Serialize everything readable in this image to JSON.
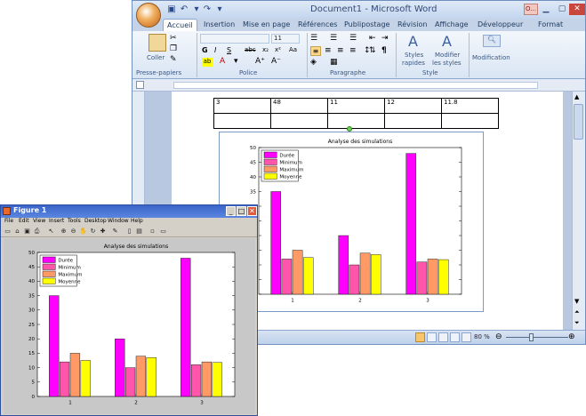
{
  "word": {
    "title": "Document1 - Microsoft Word",
    "contextual_tab": "O...",
    "tabs": [
      "Accueil",
      "Insertion",
      "Mise en page",
      "Références",
      "Publipostage",
      "Révision",
      "Affichage",
      "Développeur",
      "Format"
    ],
    "active_tab": "Accueil",
    "ribbon": {
      "paste_label": "Coller",
      "clipboard_group": "Presse-papiers",
      "font_group": "Police",
      "font_size": "11",
      "paragraph_group": "Paragraphe",
      "styles_group": "Style",
      "quick_styles_label_1": "Styles",
      "quick_styles_label_2": "rapides",
      "change_styles_label_1": "Modifier",
      "change_styles_label_2": "les styles",
      "editing_label": "Modification"
    },
    "table_row": [
      "3",
      "48",
      "11",
      "12",
      "11.8"
    ],
    "zoom": "80 %"
  },
  "figure": {
    "title": "Figure 1",
    "menu": [
      "File",
      "Edit",
      "View",
      "Insert",
      "Tools",
      "Desktop",
      "Window",
      "Help"
    ]
  },
  "chart_data": [
    {
      "type": "bar",
      "title": "Analyse des simulations",
      "categories": [
        "1",
        "2",
        "3"
      ],
      "series": [
        {
          "name": "Durée",
          "values": [
            35,
            20,
            48
          ]
        },
        {
          "name": "Minimum",
          "values": [
            12,
            10,
            11
          ]
        },
        {
          "name": "Maximum",
          "values": [
            15,
            14,
            12
          ]
        },
        {
          "name": "Moyenne",
          "values": [
            12.5,
            13.5,
            11.8
          ]
        }
      ],
      "colors": [
        "#ff00ff",
        "#ff55aa",
        "#ff9966",
        "#ffff00"
      ],
      "ylim": [
        0,
        50
      ],
      "yticks": [
        0,
        5,
        10,
        15,
        20,
        25,
        30,
        35,
        40,
        45,
        50
      ],
      "legend": "top-left"
    },
    {
      "type": "bar",
      "title": "Analyse des simulations",
      "categories": [
        "1",
        "2",
        "3"
      ],
      "series": [
        {
          "name": "Durée",
          "values": [
            35,
            20,
            48
          ]
        },
        {
          "name": "Minimum",
          "values": [
            12,
            10,
            11
          ]
        },
        {
          "name": "Maximum",
          "values": [
            15,
            14,
            12
          ]
        },
        {
          "name": "Moyenne",
          "values": [
            12.5,
            13.5,
            11.8
          ]
        }
      ],
      "colors": [
        "#ff00ff",
        "#ff55aa",
        "#ff9966",
        "#ffff00"
      ],
      "ylim": [
        0,
        50
      ],
      "yticks": [
        0,
        5,
        10,
        15,
        20,
        25,
        30,
        35,
        40,
        45,
        50
      ],
      "legend": "top-left"
    }
  ]
}
